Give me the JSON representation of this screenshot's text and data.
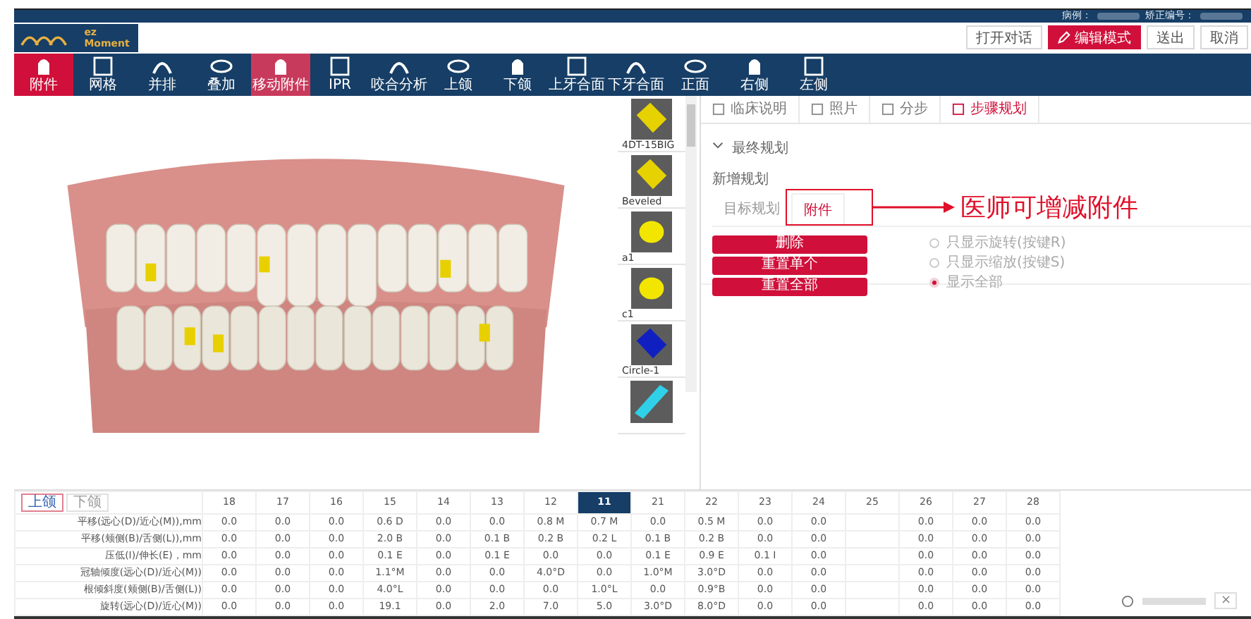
{
  "header": {
    "logo": "ez Moment",
    "case_label": "病例：",
    "id_label": "矫正编号：",
    "buttons": [
      {
        "label": "打开对话",
        "kind": "plain"
      },
      {
        "label": "编辑模式",
        "kind": "primary"
      },
      {
        "label": "送出",
        "kind": "plain"
      },
      {
        "label": "取消",
        "kind": "plain"
      }
    ]
  },
  "toolbar": [
    {
      "label": "附件",
      "selected": true
    },
    {
      "label": "网格",
      "selected": false
    },
    {
      "label": "并排",
      "selected": false
    },
    {
      "label": "叠加",
      "selected": false
    },
    {
      "label": "移动附件",
      "selected": true
    },
    {
      "label": "IPR",
      "selected": false
    },
    {
      "label": "咬合分析",
      "selected": false
    },
    {
      "label": "上颌",
      "selected": false
    },
    {
      "label": "下颌",
      "selected": false
    },
    {
      "label": "上牙合面",
      "selected": false
    },
    {
      "label": "下牙合面",
      "selected": false
    },
    {
      "label": "正面",
      "selected": false
    },
    {
      "label": "右侧",
      "selected": false
    },
    {
      "label": "左侧",
      "selected": false
    }
  ],
  "attachments": [
    {
      "label": "4DT-15BIG",
      "color": "#e6d200"
    },
    {
      "label": "Beveled",
      "color": "#e6d200"
    },
    {
      "label": "a1",
      "color": "#f2e600"
    },
    {
      "label": "c1",
      "color": "#f2e600"
    },
    {
      "label": "Circle-1",
      "color": "#1020c0"
    },
    {
      "color": "#30d0e8"
    }
  ],
  "panel": {
    "tabs": [
      {
        "label": "临床说明",
        "selected": false
      },
      {
        "label": "照片",
        "selected": false
      },
      {
        "label": "分步",
        "selected": false
      },
      {
        "label": "步骤规划",
        "selected": true
      }
    ],
    "section": {
      "title": "最终规划",
      "expanded": true
    },
    "subtitle": "新增规划",
    "subtabs": [
      {
        "label": "目标规划",
        "selected": false
      },
      {
        "label": "附件",
        "selected": true
      }
    ],
    "actions": [
      "删除",
      "重置单个",
      "重置全部"
    ],
    "radios": [
      {
        "label": "只显示旋转(按键R)",
        "selected": false
      },
      {
        "label": "只显示缩放(按键S)",
        "selected": false
      },
      {
        "label": "显示全部",
        "selected": true
      }
    ]
  },
  "annotation": "医师可增减附件",
  "table": {
    "jaw_tabs": [
      {
        "label": "上颌",
        "selected": true
      },
      {
        "label": "下颌",
        "selected": false
      }
    ],
    "columns": [
      {
        "label": "18",
        "selected": false
      },
      {
        "label": "17",
        "selected": false
      },
      {
        "label": "16",
        "selected": false
      },
      {
        "label": "15",
        "selected": false
      },
      {
        "label": "14",
        "selected": false
      },
      {
        "label": "13",
        "selected": false
      },
      {
        "label": "12",
        "selected": false
      },
      {
        "label": "11",
        "selected": true
      },
      {
        "label": "21",
        "selected": false
      },
      {
        "label": "22",
        "selected": false
      },
      {
        "label": "23",
        "selected": false
      },
      {
        "label": "24",
        "selected": false
      },
      {
        "label": "25",
        "selected": false
      },
      {
        "label": "26",
        "selected": false
      },
      {
        "label": "27",
        "selected": false
      },
      {
        "label": "28",
        "selected": false
      }
    ],
    "rows": [
      {
        "label": "平移(远心(D)/近心(M)),mm",
        "cells": [
          "0.0",
          "0.0",
          "0.0",
          "0.6 D",
          "0.0",
          "0.0",
          "0.8 M",
          "0.7 M",
          "0.0",
          "0.5 M",
          "0.0",
          "0.0",
          null,
          "0.0",
          "0.0",
          "0.0"
        ]
      },
      {
        "label": "平移(颊侧(B)/舌侧(L)),mm",
        "cells": [
          "0.0",
          "0.0",
          "0.0",
          "2.0 B",
          "0.0",
          "0.1 B",
          "0.2 B",
          "0.2 L",
          "0.1 B",
          "0.2 B",
          "0.0",
          "0.0",
          null,
          "0.0",
          "0.0",
          "0.0"
        ]
      },
      {
        "label": "压低(I)/伸长(E)，mm",
        "cells": [
          "0.0",
          "0.0",
          "0.0",
          "0.1 E",
          "0.0",
          "0.1 E",
          "0.0",
          "0.0",
          "0.1 E",
          "0.9 E",
          "0.1 I",
          "0.0",
          null,
          "0.0",
          "0.0",
          "0.0"
        ]
      },
      {
        "label": "冠轴倾度(远心(D)/近心(M))",
        "cells": [
          "0.0",
          "0.0",
          "0.0",
          "1.1°M",
          "0.0",
          "0.0",
          "4.0°D",
          "0.0",
          "1.0°M",
          "3.0°D",
          "0.0",
          "0.0",
          null,
          "0.0",
          "0.0",
          "0.0"
        ]
      },
      {
        "label": "根倾斜度(颊侧(B)/舌侧(L))",
        "cells": [
          "0.0",
          "0.0",
          "0.0",
          "4.0°L",
          "0.0",
          "0.0",
          "0.0",
          "1.0°L",
          "0.0",
          "0.9°B",
          "0.0",
          "0.0",
          null,
          "0.0",
          "0.0",
          "0.0"
        ]
      },
      {
        "label": "旋转(远心(D)/近心(M))",
        "cells": [
          "0.0",
          "0.0",
          "0.0",
          "19.1",
          "0.0",
          "2.0",
          "7.0",
          "5.0",
          "3.0°D",
          "8.0°D",
          "0.0",
          "0.0",
          null,
          "0.0",
          "0.0",
          "0.0"
        ]
      }
    ]
  },
  "notice": {
    "close": "×"
  }
}
